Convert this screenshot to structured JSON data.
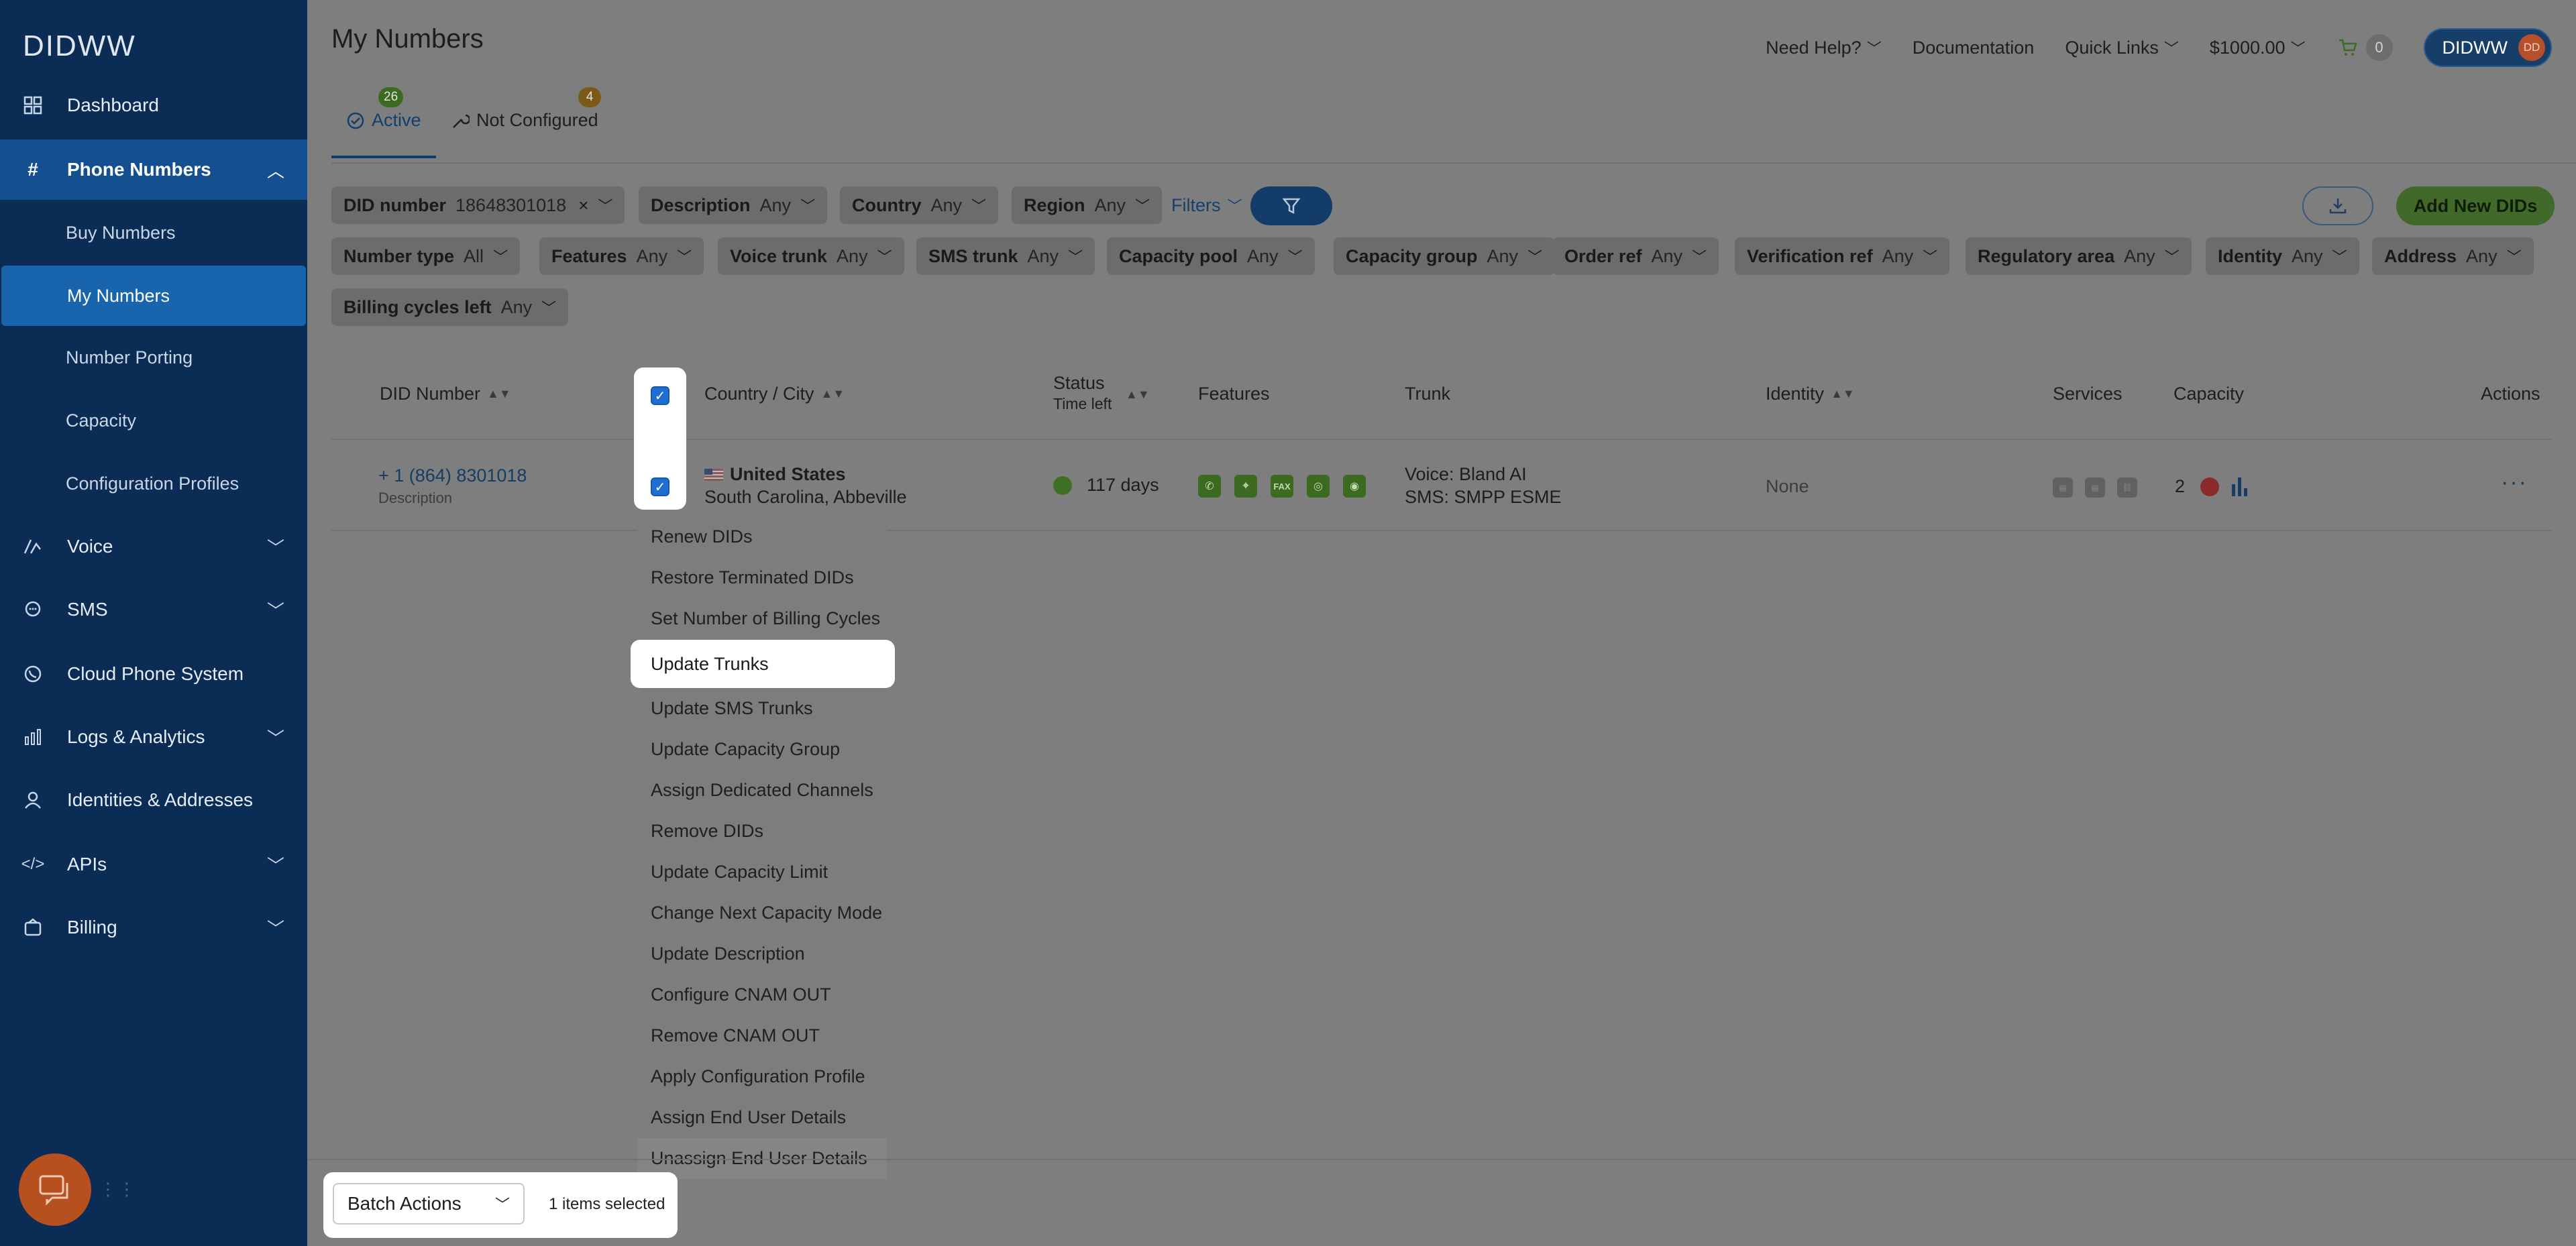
{
  "brand": {
    "logo": "DIDWW"
  },
  "sidebar": {
    "items": [
      {
        "label": "Dashboard",
        "icon": "grid-icon"
      },
      {
        "label": "Phone Numbers",
        "icon": "hash-icon",
        "expanded": true,
        "children": [
          {
            "label": "Buy Numbers"
          },
          {
            "label": "My Numbers",
            "selected": true
          },
          {
            "label": "Number Porting"
          },
          {
            "label": "Capacity"
          },
          {
            "label": "Configuration Profiles"
          }
        ]
      },
      {
        "label": "Voice",
        "icon": "voice-icon"
      },
      {
        "label": "SMS",
        "icon": "sms-icon"
      },
      {
        "label": "Cloud Phone System",
        "icon": "phone-icon"
      },
      {
        "label": "Logs & Analytics",
        "icon": "bar-chart-icon"
      },
      {
        "label": "Identities & Addresses",
        "icon": "user-icon"
      },
      {
        "label": "APIs",
        "icon": "code-icon"
      },
      {
        "label": "Billing",
        "icon": "wallet-icon"
      }
    ]
  },
  "header": {
    "title": "My Numbers",
    "need_help": "Need Help?",
    "documentation": "Documentation",
    "quick_links": "Quick Links",
    "balance": "$1000.00",
    "cart_count": "0",
    "account": "DIDWW",
    "avatar": "DD"
  },
  "tabs": [
    {
      "label": "Active",
      "count": "26",
      "badge_color": "#3c6a20"
    },
    {
      "label": "Not Configured",
      "count": "4",
      "badge_color": "#7a5a16"
    }
  ],
  "filters": {
    "did_number": {
      "label": "DID number",
      "value": "18648301018"
    },
    "description": {
      "label": "Description",
      "value": "Any"
    },
    "country": {
      "label": "Country",
      "value": "Any"
    },
    "region": {
      "label": "Region",
      "value": "Any"
    },
    "filters_link": "Filters",
    "row2": [
      {
        "label": "Number type",
        "value": "All"
      },
      {
        "label": "Features",
        "value": "Any"
      },
      {
        "label": "Voice trunk",
        "value": "Any"
      },
      {
        "label": "SMS trunk",
        "value": "Any"
      },
      {
        "label": "Capacity pool",
        "value": "Any"
      },
      {
        "label": "Capacity group",
        "value": "Any"
      },
      {
        "label": "Order ref",
        "value": "Any"
      },
      {
        "label": "Verification ref",
        "value": "Any"
      },
      {
        "label": "Regulatory area",
        "value": "Any"
      },
      {
        "label": "Identity",
        "value": "Any"
      },
      {
        "label": "Address",
        "value": "Any"
      }
    ],
    "row3": [
      {
        "label": "Billing cycles left",
        "value": "Any"
      }
    ]
  },
  "actions": {
    "add_new": "Add New DIDs"
  },
  "table": {
    "headers": {
      "did_number": "DID Number",
      "country_city": "Country / City",
      "status": "Status",
      "time_left": "Time left",
      "features": "Features",
      "trunk": "Trunk",
      "identity": "Identity",
      "services": "Services",
      "capacity": "Capacity",
      "actions": "Actions"
    },
    "rows": [
      {
        "number": "+ 1 (864) 8301018",
        "description": "Description",
        "country": "United States",
        "city": "South Carolina, Abbeville",
        "status": "117 days",
        "features": [
          "phone",
          "location",
          "FAX",
          "whatsapp",
          "sms"
        ],
        "trunk_voice": "Voice: Bland AI",
        "trunk_sms": "SMS: SMPP ESME",
        "identity": "None",
        "capacity": "2"
      }
    ]
  },
  "batch_menu": {
    "items": [
      "Renew DIDs",
      "Restore Terminated DIDs",
      "Set Number of Billing Cycles",
      "Update Trunks",
      "Update SMS Trunks",
      "Update Capacity Group",
      "Assign Dedicated Channels",
      "Remove DIDs",
      "Update Capacity Limit",
      "Change Next Capacity Mode",
      "Update Description",
      "Configure CNAM OUT",
      "Remove CNAM OUT",
      "Apply Configuration Profile",
      "Assign End User Details",
      "Unassign End User Details"
    ],
    "highlighted": "Update Trunks"
  },
  "batch_bar": {
    "select_label": "Batch Actions",
    "selected_count": "1 items selected"
  }
}
